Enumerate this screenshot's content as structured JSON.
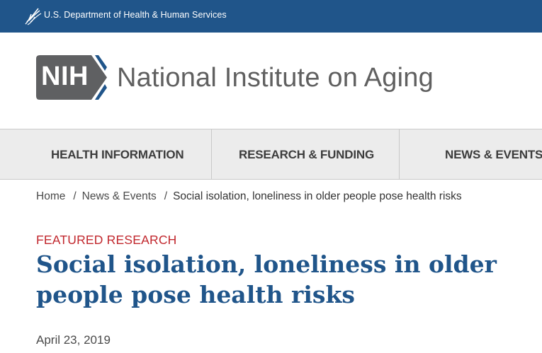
{
  "hhs_bar": {
    "agency_name": "U.S. Department of Health & Human Services",
    "logo_icon": "hhs-eagle-icon"
  },
  "header": {
    "badge_text": "NIH",
    "site_name": "National Institute on Aging",
    "badge_color": "#5f6062"
  },
  "nav": {
    "items": [
      {
        "label": "HEALTH INFORMATION"
      },
      {
        "label": "RESEARCH & FUNDING"
      },
      {
        "label": "NEWS & EVENTS"
      }
    ]
  },
  "breadcrumb": {
    "items": [
      "Home",
      "News & Events",
      "Social isolation, loneliness in older people pose health risks"
    ],
    "separator": "/"
  },
  "article": {
    "kicker": "FEATURED RESEARCH",
    "title": "Social isolation, loneliness in older people pose health risks",
    "date": "April 23, 2019"
  },
  "colors": {
    "hhs_blue": "#20558a",
    "accent_red": "#c1272d",
    "nav_bg": "#ececec"
  }
}
